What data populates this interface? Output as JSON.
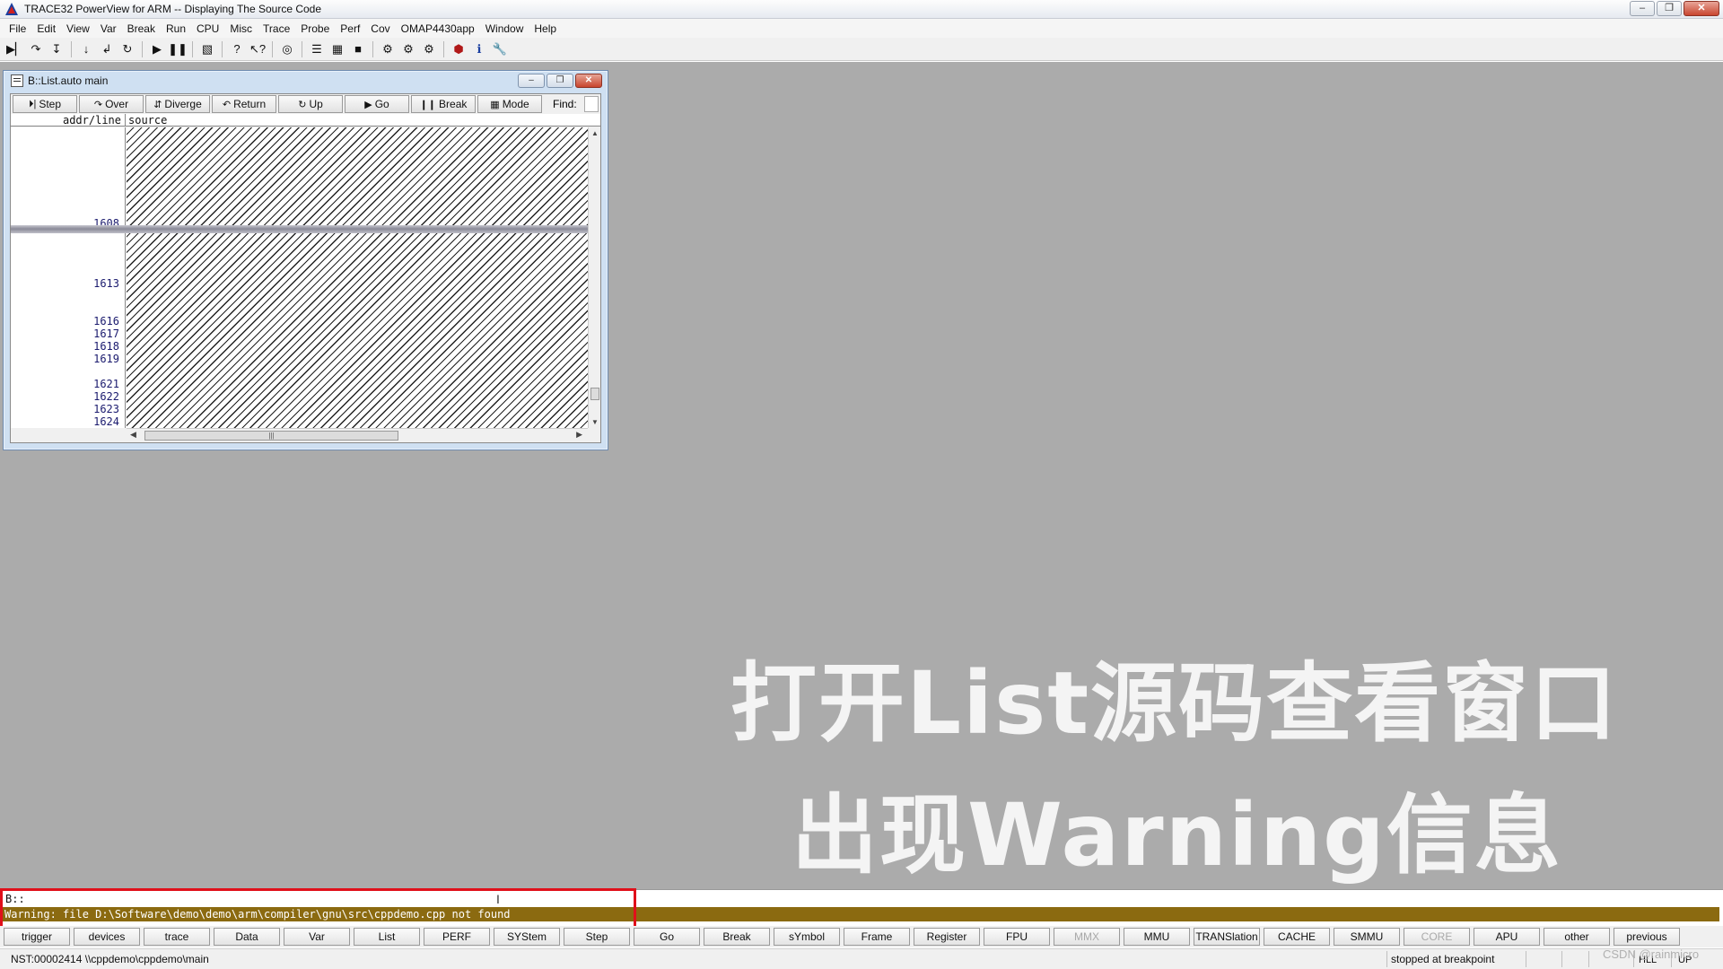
{
  "titlebar": {
    "title": "TRACE32 PowerView for ARM -- Displaying The Source Code",
    "minimize": "–",
    "maximize": "❐",
    "close": "✕"
  },
  "menubar": {
    "items": [
      "File",
      "Edit",
      "View",
      "Var",
      "Break",
      "Run",
      "CPU",
      "Misc",
      "Trace",
      "Probe",
      "Perf",
      "Cov",
      "OMAP4430app",
      "Window",
      "Help"
    ]
  },
  "toolbar": {
    "icons": [
      "step-icon",
      "step-over-icon",
      "step-diverge-icon",
      "step-into-icon",
      "return-icon",
      "up-icon",
      "go-icon",
      "break-icon",
      "trace-list-icon",
      "help-icon",
      "context-help-icon",
      "globe-icon",
      "list-icon",
      "register-icon",
      "memory-icon",
      "perf-icon",
      "perf2-icon",
      "perf3-icon",
      "record-icon",
      "info-icon",
      "tools-icon"
    ]
  },
  "list_window": {
    "title": "B::List.auto main",
    "buttons": [
      {
        "label": "Step",
        "icon": "⏵|"
      },
      {
        "label": "Over",
        "icon": "↷"
      },
      {
        "label": "Diverge",
        "icon": "⇵"
      },
      {
        "label": "Return",
        "icon": "↶"
      },
      {
        "label": "Up",
        "icon": "↻"
      },
      {
        "label": "Go",
        "icon": "▶"
      },
      {
        "label": "Break",
        "icon": "❙❙"
      },
      {
        "label": "Mode",
        "icon": "▦"
      }
    ],
    "find_label": "Find:",
    "col_addr": "addr/line",
    "col_source": "source",
    "current_line": "1608",
    "line_numbers": [
      "1608",
      "1613",
      "1616",
      "1617",
      "1618",
      "1619",
      "1621",
      "1622",
      "1623",
      "1624"
    ]
  },
  "captions": {
    "line1": "打开List源码查看窗口",
    "line2": "出现Warning信息"
  },
  "command": {
    "prompt": "B::",
    "warning": "Warning: file D:\\Software\\demo\\demo\\arm\\compiler\\gnu\\src\\cppdemo.cpp not found"
  },
  "softkeys": [
    {
      "label": "trigger",
      "enabled": true
    },
    {
      "label": "devices",
      "enabled": true
    },
    {
      "label": "trace",
      "enabled": true
    },
    {
      "label": "Data",
      "enabled": true
    },
    {
      "label": "Var",
      "enabled": true
    },
    {
      "label": "List",
      "enabled": true
    },
    {
      "label": "PERF",
      "enabled": true
    },
    {
      "label": "SYStem",
      "enabled": true
    },
    {
      "label": "Step",
      "enabled": true
    },
    {
      "label": "Go",
      "enabled": true
    },
    {
      "label": "Break",
      "enabled": true
    },
    {
      "label": "sYmbol",
      "enabled": true
    },
    {
      "label": "Frame",
      "enabled": true
    },
    {
      "label": "Register",
      "enabled": true
    },
    {
      "label": "FPU",
      "enabled": true
    },
    {
      "label": "MMX",
      "enabled": false
    },
    {
      "label": "MMU",
      "enabled": true
    },
    {
      "label": "TRANSlation",
      "enabled": true
    },
    {
      "label": "CACHE",
      "enabled": true
    },
    {
      "label": "SMMU",
      "enabled": true
    },
    {
      "label": "CORE",
      "enabled": false
    },
    {
      "label": "APU",
      "enabled": true
    },
    {
      "label": "other",
      "enabled": true
    },
    {
      "label": "previous",
      "enabled": true
    }
  ],
  "statusbar": {
    "address": "NST:00002414  \\\\cppdemo\\cppdemo\\main",
    "state": "stopped at breakpoint",
    "mode": "HLL",
    "up": "UP"
  },
  "watermark": "CSDN @rainmicro",
  "colors": {
    "workspace": "#ababab",
    "warning_bg": "#8b6a10",
    "highlight_box": "#e0101a"
  }
}
